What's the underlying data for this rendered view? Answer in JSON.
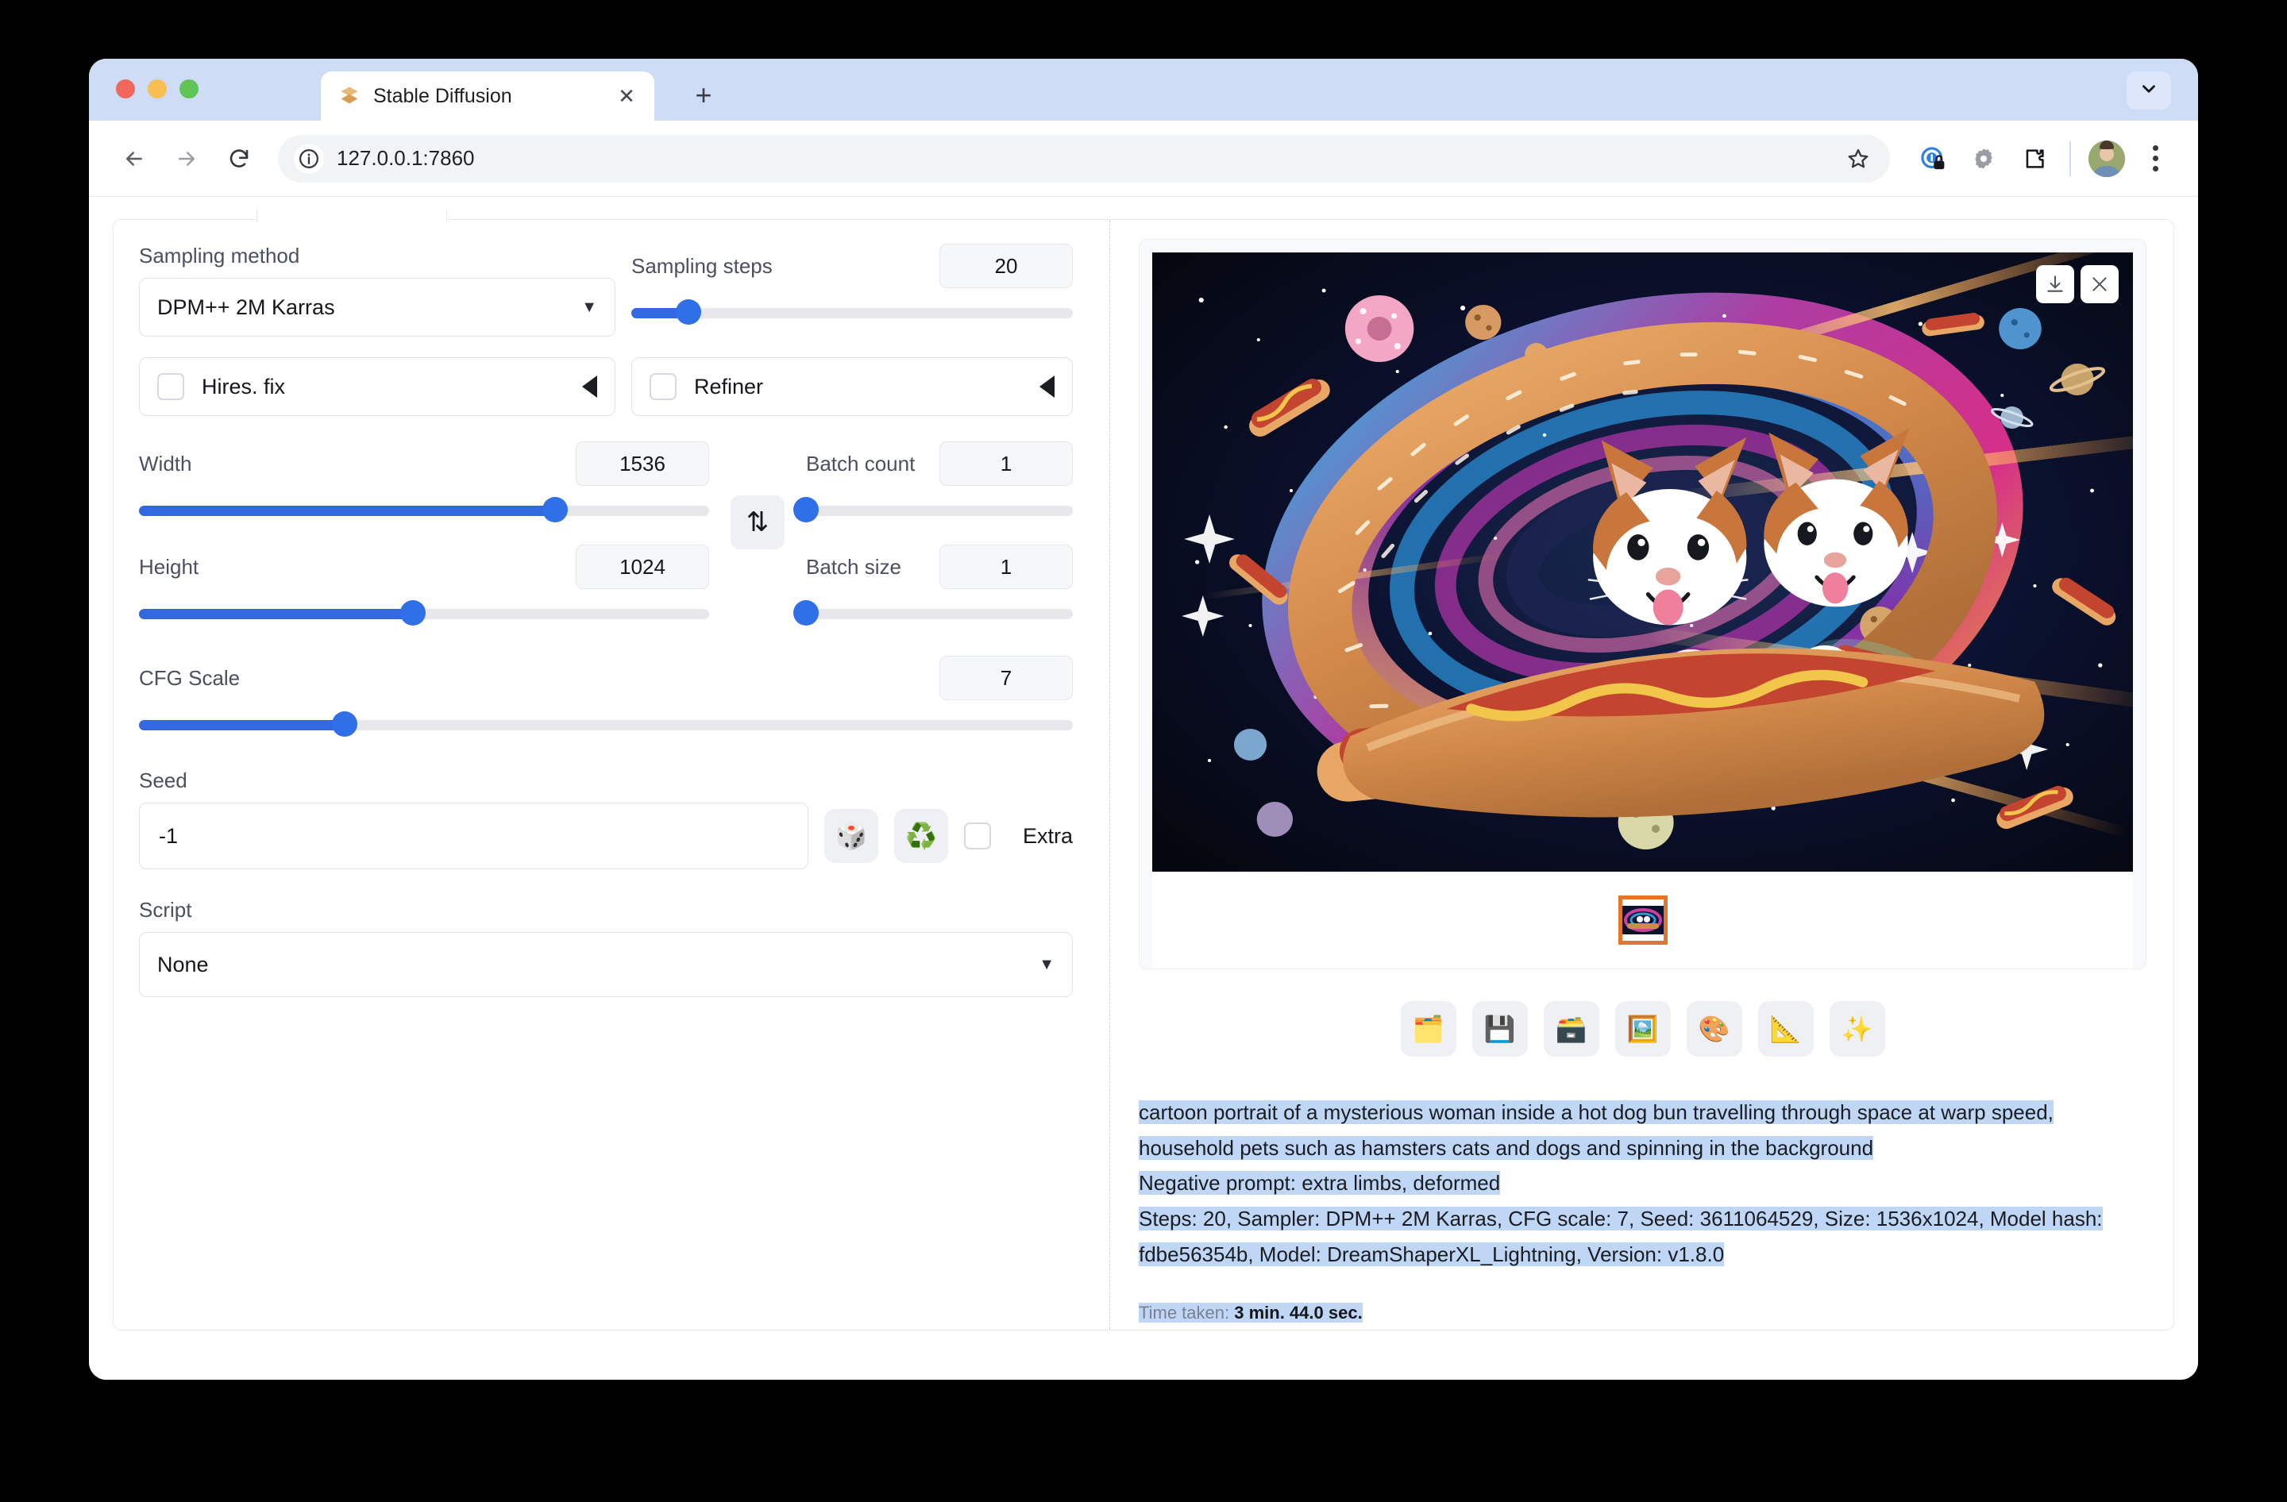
{
  "browser": {
    "tab": {
      "title": "Stable Diffusion",
      "favicon": "stable-diffusion-logo",
      "close_label": "✕"
    },
    "new_tab_label": "+",
    "url": "127.0.0.1:7860",
    "nav": {
      "back": "←",
      "forward": "→",
      "reload": "⟳"
    },
    "icons": {
      "info": "site-info-icon",
      "star": "bookmark-icon",
      "password_manager": "password-manager-icon",
      "extension_bug": "extension-icon",
      "extensions": "puzzle-icon",
      "avatar": "profile-avatar",
      "menu": "kebab-menu-icon",
      "tab_list": "chevron-down-icon"
    }
  },
  "left_panel": {
    "sampling_method": {
      "label": "Sampling method",
      "value": "DPM++ 2M Karras",
      "caret": "▼"
    },
    "sampling_steps": {
      "label": "Sampling steps",
      "value": "20",
      "percent": 13
    },
    "hires_fix": {
      "label": "Hires. fix",
      "checked": false
    },
    "refiner": {
      "label": "Refiner",
      "checked": false
    },
    "width": {
      "label": "Width",
      "value": "1536",
      "percent": 73
    },
    "height": {
      "label": "Height",
      "value": "1024",
      "percent": 48
    },
    "batch_count": {
      "label": "Batch count",
      "value": "1",
      "percent": 0
    },
    "batch_size": {
      "label": "Batch size",
      "value": "1",
      "percent": 0
    },
    "cfg_scale": {
      "label": "CFG Scale",
      "value": "7",
      "percent": 22
    },
    "seed": {
      "label": "Seed",
      "value": "-1"
    },
    "seed_random": {
      "icon": "🎲",
      "name": "dice"
    },
    "seed_recycle": {
      "icon": "♻️",
      "name": "recycle"
    },
    "extra": {
      "label": "Extra",
      "checked": false
    },
    "script": {
      "label": "Script",
      "value": "None",
      "caret": "▼"
    },
    "swap": {
      "icon": "⇅",
      "name": "swap-dimensions"
    }
  },
  "right_panel": {
    "image_controls": {
      "download": "download-icon",
      "close": "close-icon"
    },
    "gallery_thumb_selected": true,
    "toolbar": [
      {
        "icon": "🗂️",
        "name": "open-folder"
      },
      {
        "icon": "💾",
        "name": "save"
      },
      {
        "icon": "🗃️",
        "name": "save-zip"
      },
      {
        "icon": "🖼️",
        "name": "send-to-img2img"
      },
      {
        "icon": "🎨",
        "name": "send-to-inpaint"
      },
      {
        "icon": "📐",
        "name": "send-to-extras"
      },
      {
        "icon": "✨",
        "name": "upscale"
      }
    ],
    "metadata": {
      "prompt": "cartoon portrait of a mysterious woman inside a hot dog bun travelling through space at warp speed, household pets such as hamsters cats and dogs and spinning in the background",
      "negative_prompt": "Negative prompt: extra limbs, deformed",
      "params": "Steps: 20, Sampler: DPM++ 2M Karras, CFG scale: 7, Seed: 3611064529, Size: 1536x1024, Model hash: fdbe56354b, Model: DreamShaperXL_Lightning, Version: v1.8.0",
      "time_taken_label": "Time taken:",
      "time_taken_value": "3 min. 44.0 sec."
    }
  },
  "colors": {
    "accent_blue": "#2f6fe8",
    "tab_strip": "#cfdcf6",
    "selection_highlight": "#bfd7f5",
    "thumb_border": "#e2772c"
  }
}
